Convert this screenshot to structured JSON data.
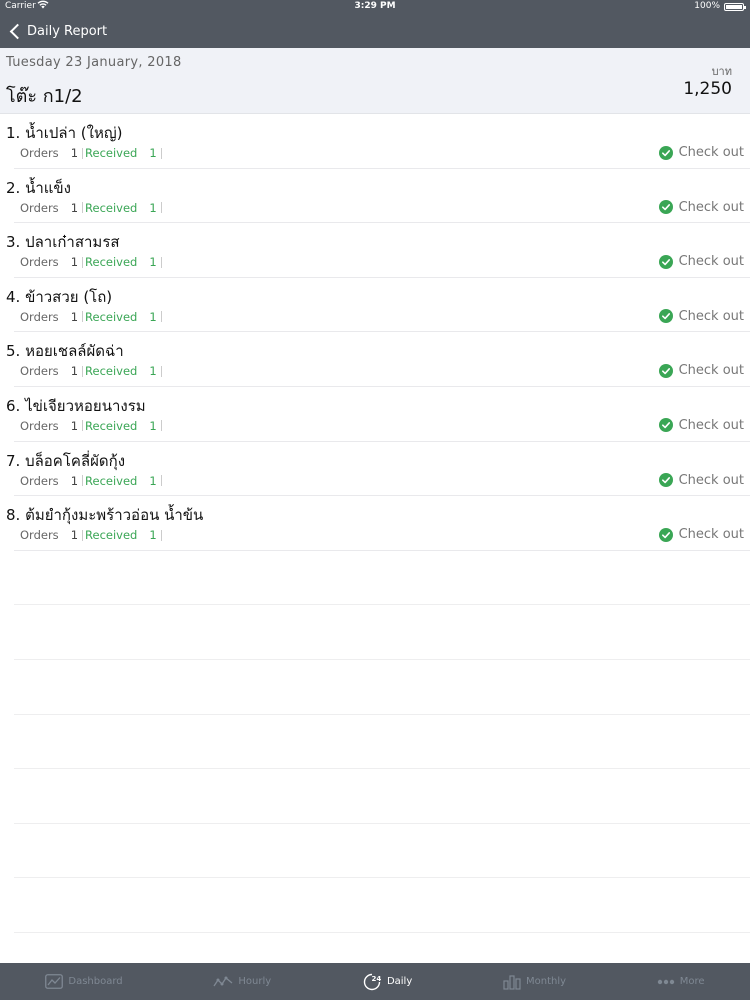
{
  "status_bar": {
    "carrier": "Carrier",
    "time": "3:29 PM",
    "battery": "100%"
  },
  "nav": {
    "back_label": "Daily Report"
  },
  "header": {
    "date": "Tuesday 23 January, 2018",
    "table_name": "โต๊ะ ก1/2",
    "currency": "บาท",
    "total": "1,250"
  },
  "labels": {
    "orders": "Orders",
    "received": "Received",
    "checkout": "Check out"
  },
  "items": [
    {
      "name": "1. น้ำเปล่า (ใหญ่)",
      "orders": "1",
      "received": "1"
    },
    {
      "name": "2. น้ำแข็ง",
      "orders": "1",
      "received": "1"
    },
    {
      "name": "3. ปลาเก๋าสามรส",
      "orders": "1",
      "received": "1"
    },
    {
      "name": "4. ข้าวสวย (โถ)",
      "orders": "1",
      "received": "1"
    },
    {
      "name": "5. หอยเชลล์ผัดฉ่า",
      "orders": "1",
      "received": "1"
    },
    {
      "name": "6. ไข่เจียวหอยนางรม",
      "orders": "1",
      "received": "1"
    },
    {
      "name": "7. บล็อคโคลี่ผัดกุ้ง",
      "orders": "1",
      "received": "1"
    },
    {
      "name": "8. ต้มยำกุ้งมะพร้าวอ่อน น้ำข้น",
      "orders": "1",
      "received": "1"
    }
  ],
  "tabs": [
    {
      "label": "Dashboard",
      "icon": "chart-line-icon",
      "active": false
    },
    {
      "label": "Hourly",
      "icon": "hourly-icon",
      "active": false
    },
    {
      "label": "Daily",
      "icon": "daily-24-icon",
      "active": true
    },
    {
      "label": "Monthly",
      "icon": "bar-chart-icon",
      "active": false
    },
    {
      "label": "More",
      "icon": "more-dots-icon",
      "active": false
    }
  ],
  "colors": {
    "bar": "#525861",
    "accent_green": "#3aa655",
    "header_bg": "#f0f2f7"
  }
}
